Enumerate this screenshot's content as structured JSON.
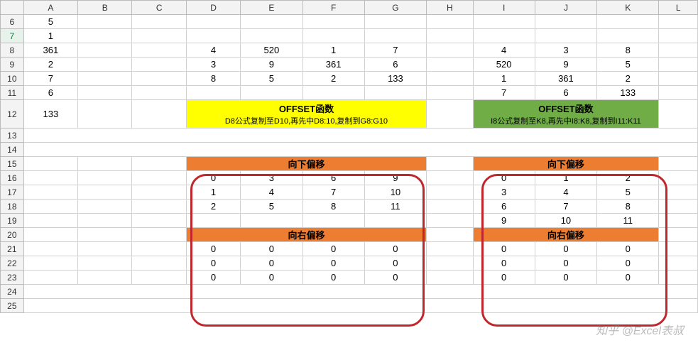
{
  "columns": [
    "A",
    "B",
    "C",
    "D",
    "E",
    "F",
    "G",
    "H",
    "I",
    "J",
    "K",
    "L"
  ],
  "rows": [
    6,
    7,
    8,
    9,
    10,
    11,
    12,
    13,
    14,
    15,
    16,
    17,
    18,
    19,
    20,
    21,
    22,
    23,
    24,
    25
  ],
  "colA": {
    "6": "5",
    "7": "1",
    "8": "361",
    "9": "2",
    "10": "7",
    "11": "6",
    "12": "133"
  },
  "block1": {
    "r8": {
      "D": "4",
      "E": "520",
      "F": "1",
      "G": "7"
    },
    "r9": {
      "D": "3",
      "E": "9",
      "F": "361",
      "G": "6"
    },
    "r10": {
      "D": "8",
      "E": "5",
      "F": "2",
      "G": "133"
    }
  },
  "block2": {
    "r8": {
      "I": "4",
      "J": "3",
      "K": "8"
    },
    "r9": {
      "I": "520",
      "J": "9",
      "K": "5"
    },
    "r10": {
      "I": "1",
      "J": "361",
      "K": "2"
    },
    "r11": {
      "I": "7",
      "J": "6",
      "K": "133"
    }
  },
  "label1": {
    "title": "OFFSET函数",
    "sub": "D8公式复制至D10,再先中D8:10,复制到G8:G10"
  },
  "label2": {
    "title": "OFFSET函数",
    "sub": "I8公式复制至K8,再先中I8:K8,复制到I11:K11"
  },
  "headers": {
    "down": "向下偏移",
    "right": "向右偏移"
  },
  "grid1_down": {
    "r16": {
      "D": "0",
      "E": "3",
      "F": "6",
      "G": "9"
    },
    "r17": {
      "D": "1",
      "E": "4",
      "F": "7",
      "G": "10"
    },
    "r18": {
      "D": "2",
      "E": "5",
      "F": "8",
      "G": "11"
    }
  },
  "grid1_right": {
    "r21": {
      "D": "0",
      "E": "0",
      "F": "0",
      "G": "0"
    },
    "r22": {
      "D": "0",
      "E": "0",
      "F": "0",
      "G": "0"
    },
    "r23": {
      "D": "0",
      "E": "0",
      "F": "0",
      "G": "0"
    }
  },
  "grid2_down": {
    "r16": {
      "I": "0",
      "J": "1",
      "K": "2"
    },
    "r17": {
      "I": "3",
      "J": "4",
      "K": "5"
    },
    "r18": {
      "I": "6",
      "J": "7",
      "K": "8"
    },
    "r19": {
      "I": "9",
      "J": "10",
      "K": "11"
    }
  },
  "grid2_right": {
    "r21": {
      "I": "0",
      "J": "0",
      "K": "0"
    },
    "r22": {
      "I": "0",
      "J": "0",
      "K": "0"
    },
    "r23": {
      "I": "0",
      "J": "0",
      "K": "0"
    }
  },
  "watermark": "知乎 @Excel表叔"
}
